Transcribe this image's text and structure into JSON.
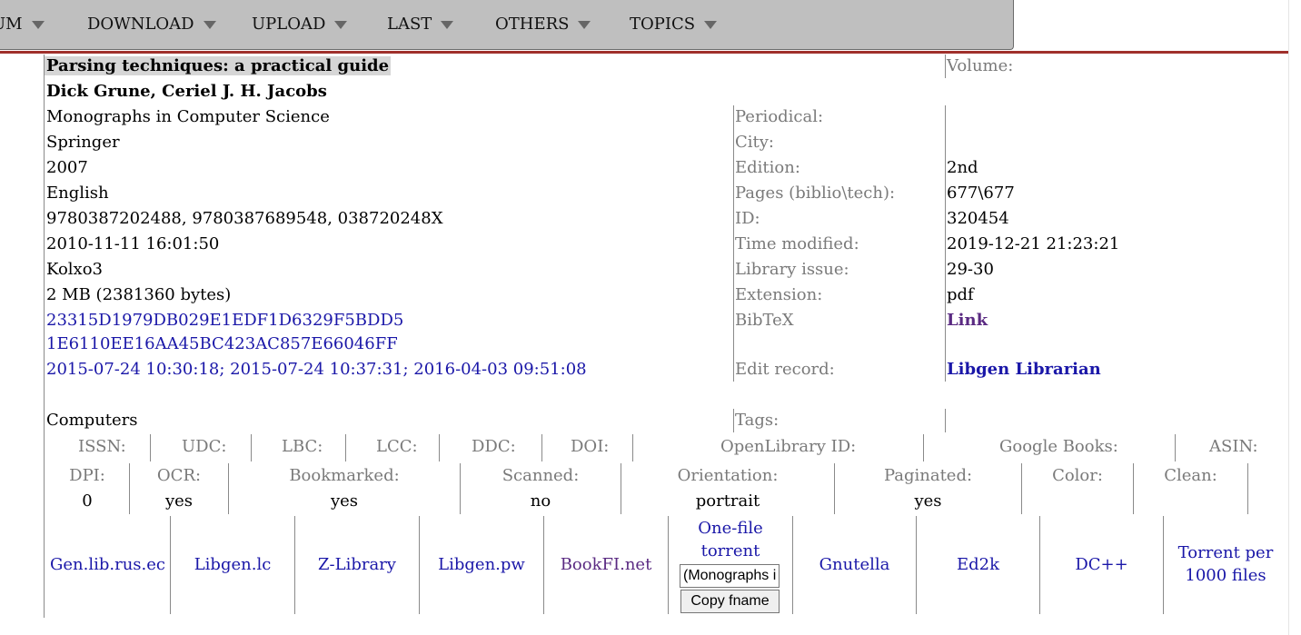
{
  "nav": {
    "items": [
      {
        "label": "UM"
      },
      {
        "label": "DOWNLOAD"
      },
      {
        "label": "UPLOAD"
      },
      {
        "label": "LAST"
      },
      {
        "label": "OTHERS"
      },
      {
        "label": "TOPICS"
      }
    ]
  },
  "book": {
    "title": "Parsing techniques: a practical guide",
    "authors": "Dick Grune, Ceriel J. H. Jacobs",
    "series": "Monographs in Computer Science",
    "publisher": "Springer",
    "year": "2007",
    "language": "English",
    "isbn": "9780387202488, 9780387689548, 038720248X",
    "time_added": "2010-11-11 16:01:50",
    "commentary": "Kolxo3",
    "size": "2 MB (2381360 bytes)",
    "md5": "23315D1979DB029E1EDF1D6329F5BDD5",
    "hash2": "1E6110EE16AA45BC423AC857E66046FF",
    "edit_times": "2015-07-24 10:30:18; 2015-07-24 10:37:31; 2016-04-03 09:51:08",
    "topic": "Computers"
  },
  "labels": {
    "volume": "Volume:",
    "periodical": "Periodical:",
    "city": "City:",
    "edition": "Edition:",
    "pages": "Pages (biblio\\tech):",
    "id": "ID:",
    "time_modified": "Time modified:",
    "library_issue": "Library issue:",
    "extension": "Extension:",
    "bibtex": "BibTeX",
    "edit_record": "Edit record:",
    "tags": "Tags:"
  },
  "values": {
    "edition": "2nd",
    "pages": "677\\677",
    "id": "320454",
    "time_modified": "2019-12-21 21:23:21",
    "library_issue": "29-30",
    "extension": "pdf",
    "bibtex_link": "Link",
    "edit_record_link": "Libgen Librarian"
  },
  "ident_labels": [
    "ISSN:",
    "UDC:",
    "LBC:",
    "LCC:",
    "DDC:",
    "DOI:",
    "OpenLibrary ID:",
    "Google Books:",
    "ASIN:"
  ],
  "tech": {
    "labels": [
      "DPI:",
      "OCR:",
      "Bookmarked:",
      "Scanned:",
      "Orientation:",
      "Paginated:",
      "Color:",
      "Clean:"
    ],
    "values": [
      "0",
      "yes",
      "yes",
      "no",
      "portrait",
      "yes",
      "",
      ""
    ]
  },
  "mirrors": {
    "items": [
      "Gen.lib.rus.ec",
      "Libgen.lc",
      "Z-Library",
      "Libgen.pw",
      "BookFI.net"
    ],
    "one_file_torrent_1": "One-file",
    "one_file_torrent_2": "torrent",
    "fname_value": "(Monographs in Computer Science) Dick Grune, Ceriel J. H. Jacobs - Parsing techniques_ a practical guide-Springer (2007).pdf",
    "copy_label": "Copy fname",
    "after": [
      "Gnutella",
      "Ed2k",
      "DC++"
    ],
    "torrent_per_1": "Torrent per",
    "torrent_per_2": "1000 files"
  },
  "colors": {
    "link": "#1a17a8",
    "visited_link": "#5a2a82",
    "label_gray": "#7a7a7a",
    "nav_bg": "#bfbfbf",
    "accent_red": "#a0302c"
  }
}
